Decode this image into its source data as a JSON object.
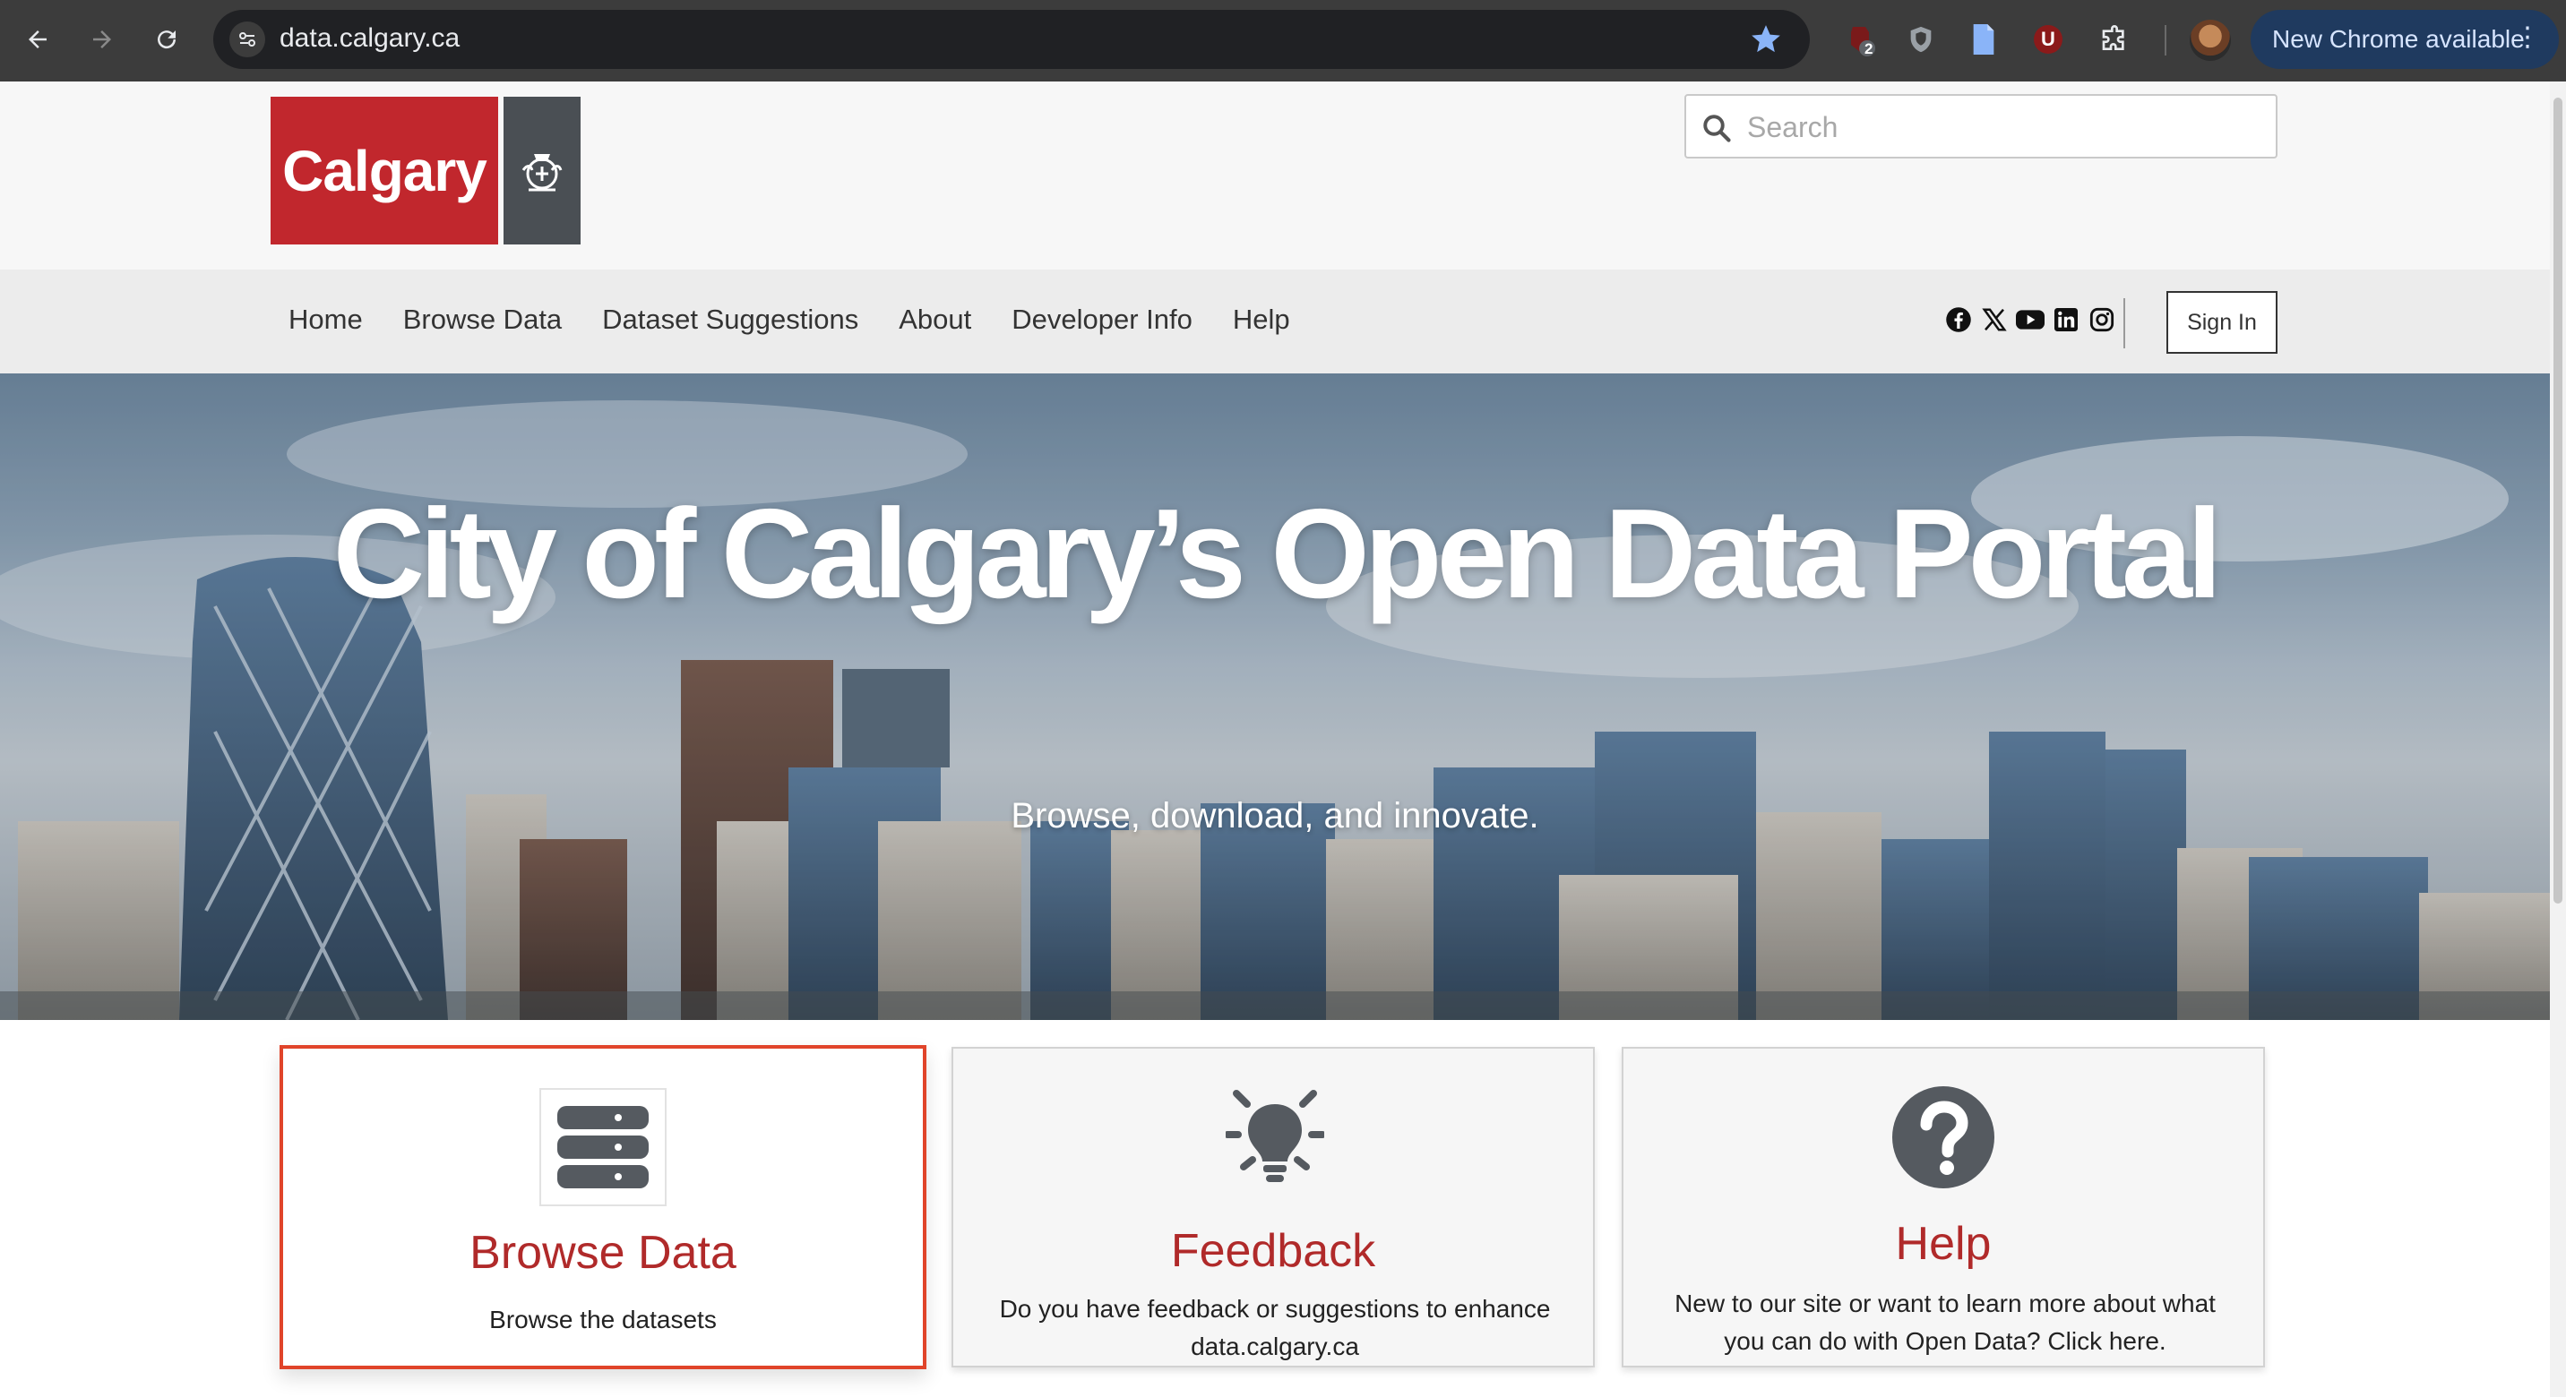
{
  "browser": {
    "url": "data.calgary.ca",
    "extension_badge": "2",
    "profile_extension_letter": "U",
    "update_label": "New Chrome available"
  },
  "header": {
    "logo_text": "Calgary",
    "search_placeholder": "Search"
  },
  "nav": {
    "items": [
      "Home",
      "Browse Data",
      "Dataset Suggestions",
      "About",
      "Developer Info",
      "Help"
    ],
    "socials": [
      "facebook-icon",
      "x-icon",
      "youtube-icon",
      "linkedin-icon",
      "instagram-icon"
    ],
    "sign_in": "Sign In"
  },
  "hero": {
    "title": "City of Calgary’s Open Data Portal",
    "subtitle": "Browse, download, and innovate."
  },
  "cards": [
    {
      "title": "Browse Data",
      "desc": "Browse the datasets",
      "icon": "database-icon",
      "highlighted": true
    },
    {
      "title": "Feedback",
      "desc": "Do you have feedback or suggestions to enhance data.calgary.ca",
      "icon": "lightbulb-icon"
    },
    {
      "title": "Help",
      "desc": "New to our site or want to learn more about what you can do with Open Data? Click here.",
      "icon": "question-circle-icon"
    }
  ],
  "colors": {
    "brand_red": "#c1272d",
    "card_title": "#b02a2a",
    "highlight_border": "#e0442a",
    "chrome_bg": "#3c3c3c",
    "star": "#8ab4f8"
  }
}
